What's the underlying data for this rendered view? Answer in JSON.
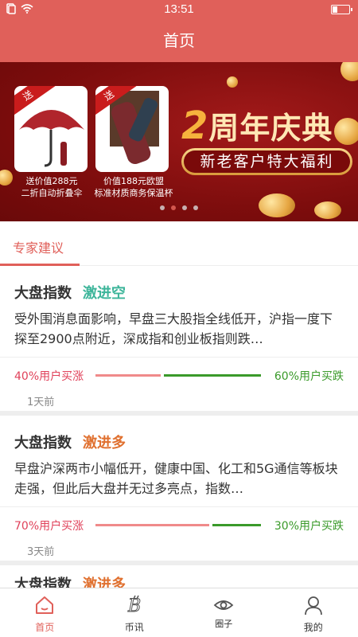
{
  "status_bar": {
    "time": "13:51"
  },
  "header": {
    "title": "首页"
  },
  "banner": {
    "products": [
      {
        "ribbon": "送",
        "caption_line1": "送价值288元",
        "caption_line2": "二折自动折叠伞"
      },
      {
        "ribbon": "送",
        "caption_line1": "价值188元欧盟",
        "caption_line2": "标准材质商务保温杯"
      }
    ],
    "title_number": "2",
    "title_text": "周年庆典",
    "subtitle": "新老客户特大福利",
    "active_dot": 1,
    "dot_count": 4
  },
  "section": {
    "tab_label": "专家建议"
  },
  "cards": [
    {
      "title": "大盘指数",
      "tag": "激进空",
      "tag_color": "#3db59a",
      "body": "受外围消息面影响，早盘三大股指全线低开，沪指一度下探至2900点附近，深成指和创业板指则跌…",
      "up_label": "40%用户买涨",
      "down_label": "60%用户买跌",
      "up_ratio": 0.4,
      "time": "1天前"
    },
    {
      "title": "大盘指数",
      "tag": "激进多",
      "tag_color": "#e0702f",
      "body": "早盘沪深两市小幅低开，健康中国、化工和5G通信等板块走强，但此后大盘并无过多亮点，指数…",
      "up_label": "70%用户买涨",
      "down_label": "30%用户买跌",
      "up_ratio": 0.7,
      "time": "3天前"
    },
    {
      "title": "大盘指数",
      "tag": "激进多",
      "tag_color": "#e0702f"
    }
  ],
  "tabbar": {
    "items": [
      {
        "label": "首页",
        "icon": "home-icon",
        "active": true
      },
      {
        "label": "币讯",
        "icon": "bitcoin-icon",
        "active": false
      },
      {
        "label": "圈子",
        "icon": "eye-icon",
        "active": false
      },
      {
        "label": "我的",
        "icon": "user-icon",
        "active": false
      }
    ]
  },
  "colors": {
    "primary": "#e0605a",
    "up": "#e0415a",
    "down": "#3a9a2a"
  }
}
